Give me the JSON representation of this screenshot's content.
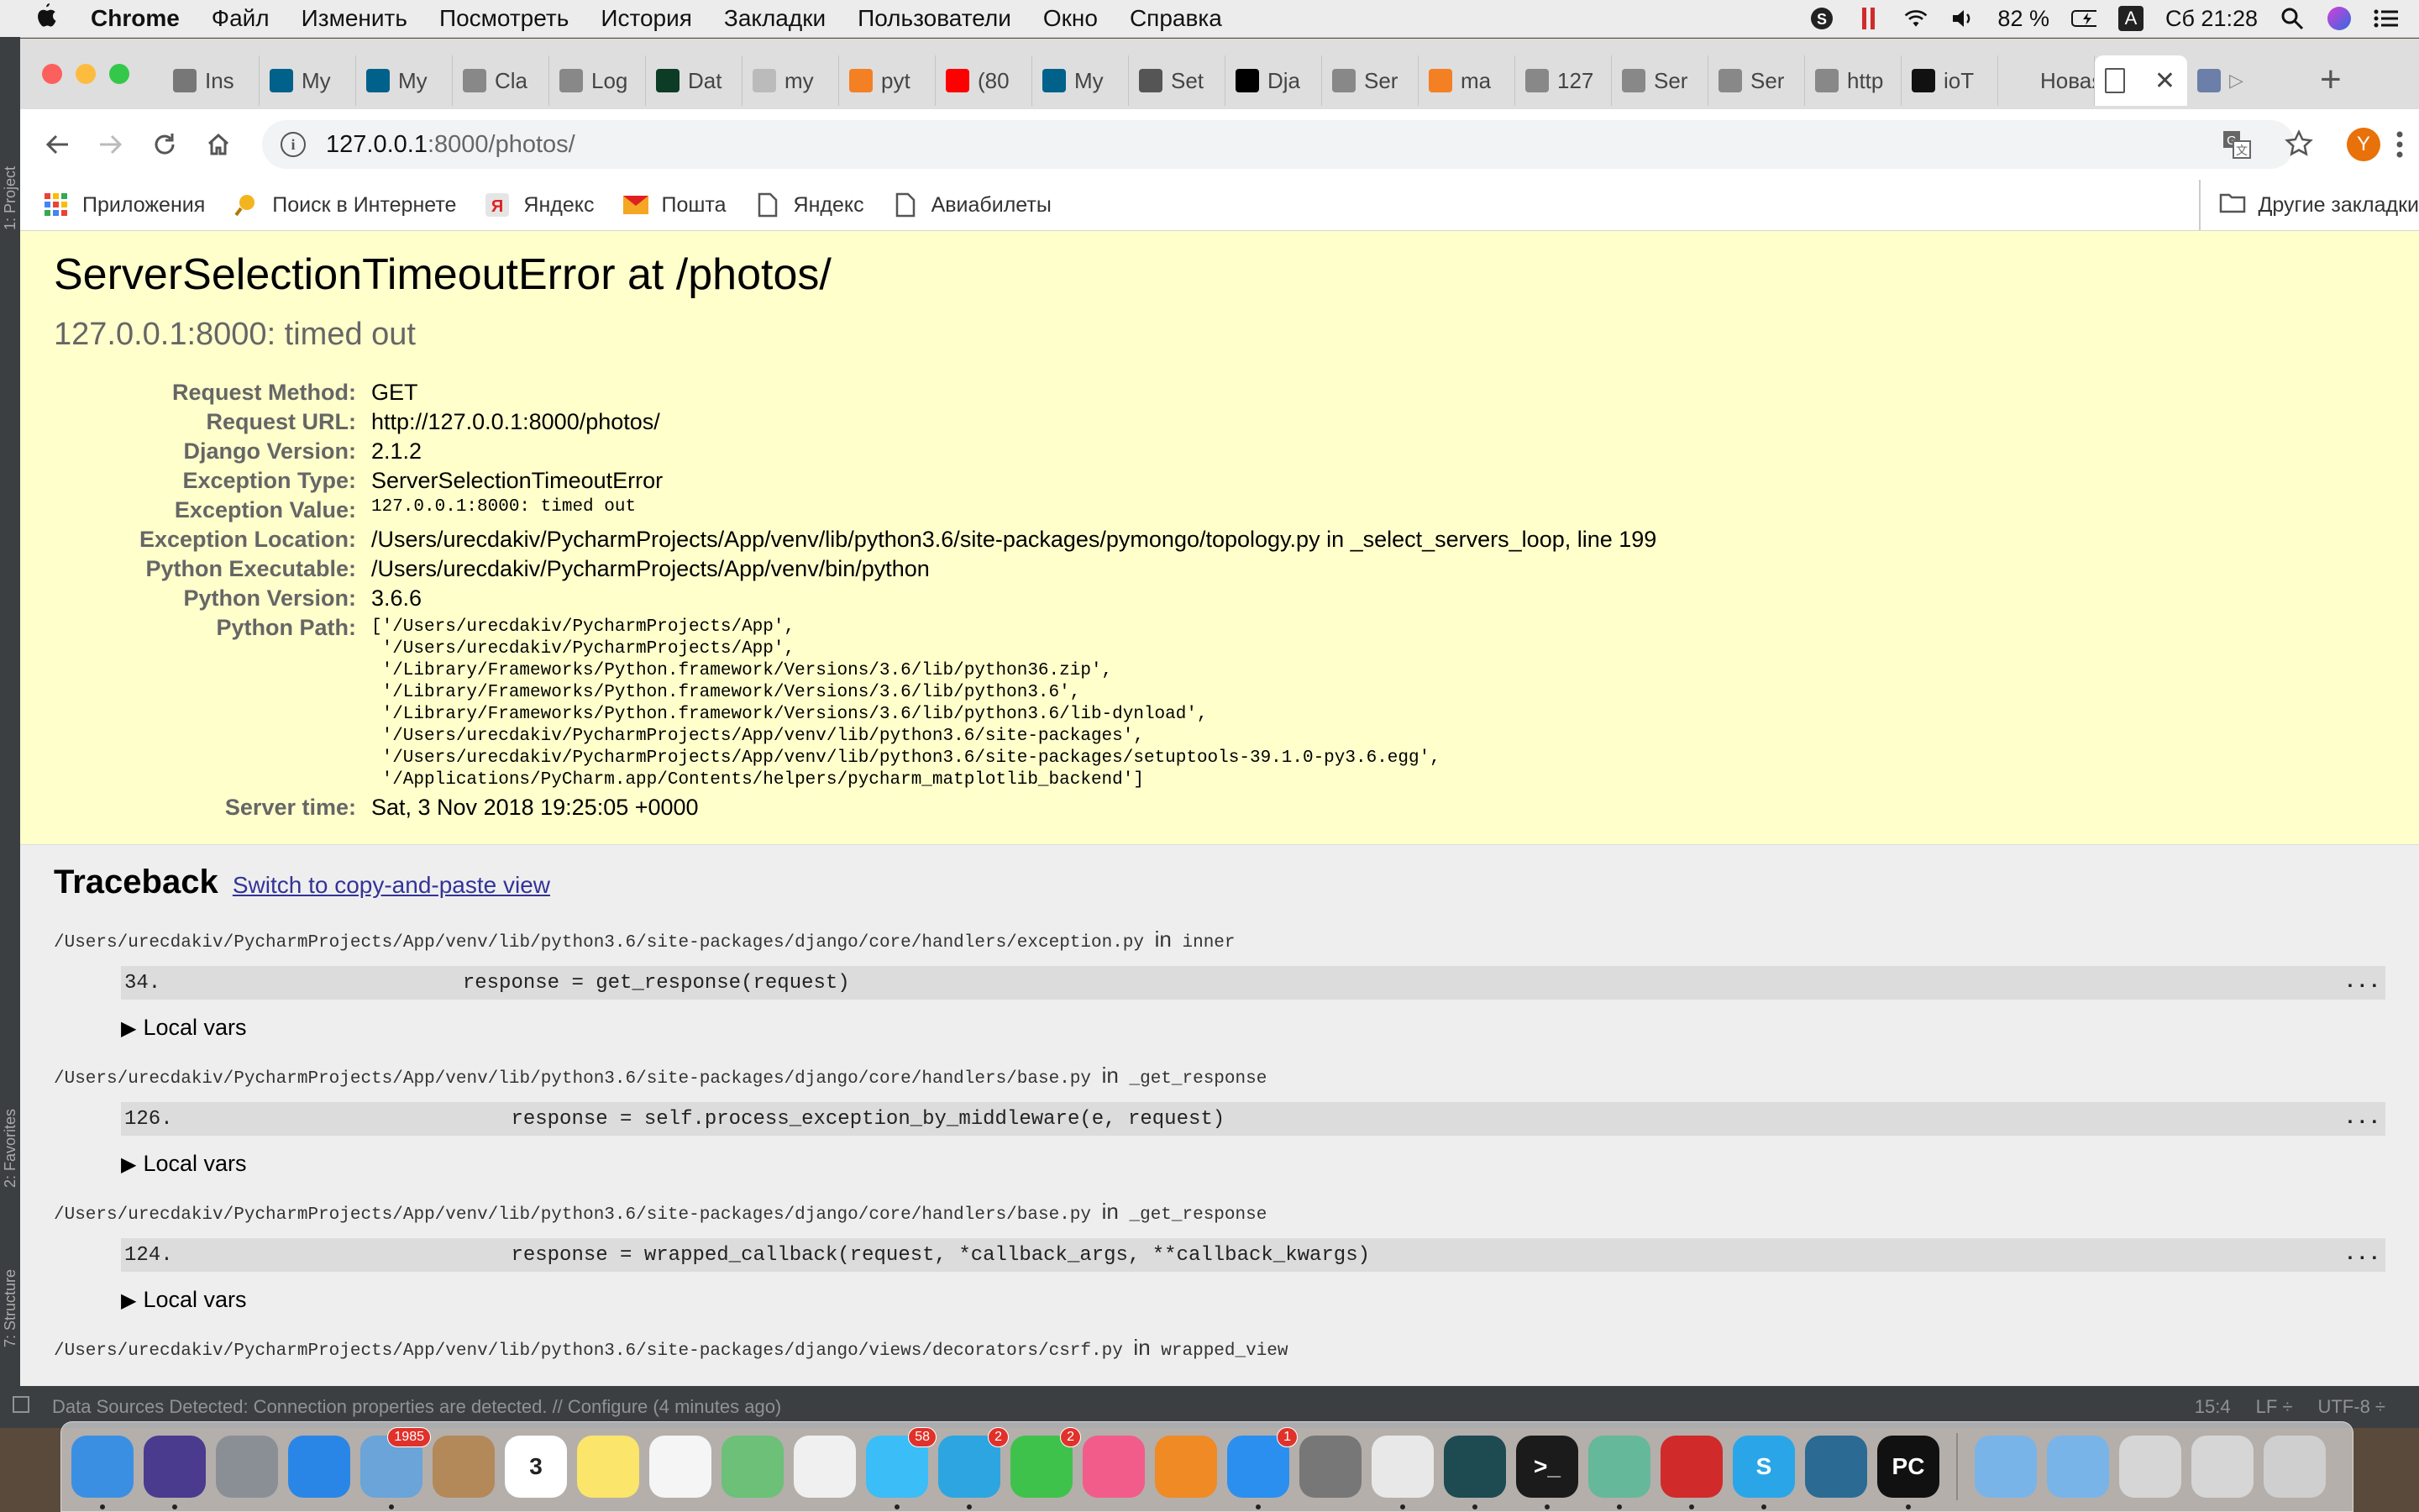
{
  "menubar": {
    "app_name": "Chrome",
    "items": [
      "Файл",
      "Изменить",
      "Посмотреть",
      "История",
      "Закладки",
      "Пользователи",
      "Окно",
      "Справка"
    ],
    "battery": "82 %",
    "input_lang": "A",
    "clock": "Сб 21:28"
  },
  "ide": {
    "side_tabs": [
      "1: Project",
      "2: Favorites",
      "7: Structure"
    ],
    "status_msg": "Data Sources Detected: Connection properties are detected. // Configure (4 minutes ago)",
    "position": "15:4",
    "line_sep": "LF ÷",
    "encoding": "UTF-8 ÷"
  },
  "tabs": [
    {
      "label": "Ins",
      "icon": "gear-icon",
      "color": "#777"
    },
    {
      "label": "My",
      "icon": "mysql-icon",
      "color": "#00618a"
    },
    {
      "label": "My",
      "icon": "mysql-icon",
      "color": "#00618a"
    },
    {
      "label": "Cla",
      "icon": "page-icon",
      "color": "#888"
    },
    {
      "label": "Log",
      "icon": "page-icon",
      "color": "#888"
    },
    {
      "label": "Dat",
      "icon": "django-icon",
      "color": "#0c3c26"
    },
    {
      "label": "my",
      "icon": "cube-icon",
      "color": "#bbb"
    },
    {
      "label": "pyt",
      "icon": "stackoverflow-icon",
      "color": "#f48024"
    },
    {
      "label": "(80",
      "icon": "youtube-icon",
      "color": "#ff0000"
    },
    {
      "label": "My",
      "icon": "mysql-icon",
      "color": "#00618a"
    },
    {
      "label": "Set",
      "icon": "table-icon",
      "color": "#555"
    },
    {
      "label": "Dja",
      "icon": "medium-icon",
      "color": "#000"
    },
    {
      "label": "Ser",
      "icon": "page-icon",
      "color": "#888"
    },
    {
      "label": "ma",
      "icon": "stackoverflow-icon",
      "color": "#f48024"
    },
    {
      "label": "127",
      "icon": "page-icon",
      "color": "#888"
    },
    {
      "label": "Ser",
      "icon": "page-icon",
      "color": "#888"
    },
    {
      "label": "Ser",
      "icon": "page-icon",
      "color": "#888"
    },
    {
      "label": "http",
      "icon": "page-icon",
      "color": "#888"
    },
    {
      "label": "ioT",
      "icon": "github-icon",
      "color": "#111"
    },
    {
      "label": "Новая",
      "icon": "",
      "color": ""
    }
  ],
  "active_tab": {
    "label": "",
    "close": "✕"
  },
  "address": {
    "host": "127.0.0.1",
    "path": ":8000/photos/"
  },
  "avatar_letter": "Y",
  "bookmarks": [
    {
      "label": "Приложения",
      "icon": "apps-grid-icon"
    },
    {
      "label": "Поиск в Интернете",
      "icon": "search-bookmark-icon"
    },
    {
      "label": "Яндекс",
      "icon": "yandex-icon"
    },
    {
      "label": "Пошта",
      "icon": "mail-icon"
    },
    {
      "label": "Яндекс",
      "icon": "page-icon"
    },
    {
      "label": "Авиабилеты",
      "icon": "page-icon"
    }
  ],
  "other_bookmarks": "Другие закладки",
  "error": {
    "title": "ServerSelectionTimeoutError at /photos/",
    "subtitle": "127.0.0.1:8000: timed out",
    "meta": [
      {
        "k": "Request Method:",
        "v": "GET"
      },
      {
        "k": "Request URL:",
        "v": "http://127.0.0.1:8000/photos/"
      },
      {
        "k": "Django Version:",
        "v": "2.1.2"
      },
      {
        "k": "Exception Type:",
        "v": "ServerSelectionTimeoutError"
      },
      {
        "k": "Exception Value:",
        "v": "127.0.0.1:8000: timed out",
        "mono": true
      },
      {
        "k": "Exception Location:",
        "v": "/Users/urecdakiv/PycharmProjects/App/venv/lib/python3.6/site-packages/pymongo/topology.py in _select_servers_loop, line 199"
      },
      {
        "k": "Python Executable:",
        "v": "/Users/urecdakiv/PycharmProjects/App/venv/bin/python"
      },
      {
        "k": "Python Version:",
        "v": "3.6.6"
      },
      {
        "k": "Python Path:",
        "v": "['/Users/urecdakiv/PycharmProjects/App',\n '/Users/urecdakiv/PycharmProjects/App',\n '/Library/Frameworks/Python.framework/Versions/3.6/lib/python36.zip',\n '/Library/Frameworks/Python.framework/Versions/3.6/lib/python3.6',\n '/Library/Frameworks/Python.framework/Versions/3.6/lib/python3.6/lib-dynload',\n '/Users/urecdakiv/PycharmProjects/App/venv/lib/python3.6/site-packages',\n '/Users/urecdakiv/PycharmProjects/App/venv/lib/python3.6/site-packages/setuptools-39.1.0-py3.6.egg',\n '/Applications/PyCharm.app/Contents/helpers/pycharm_matplotlib_backend']",
        "mono": true,
        "pre": true
      },
      {
        "k": "Server time:",
        "v": "Sat, 3 Nov 2018 19:25:05 +0000"
      }
    ]
  },
  "traceback": {
    "heading": "Traceback",
    "switch_link": "Switch to copy-and-paste view",
    "in_word": "in",
    "local_vars": "Local vars",
    "dots": "...",
    "frames": [
      {
        "file": "/Users/urecdakiv/PycharmProjects/App/venv/lib/python3.6/site-packages/django/core/handlers/exception.py",
        "func": "inner",
        "lineno": "34.",
        "code": "            response = get_response(request)"
      },
      {
        "file": "/Users/urecdakiv/PycharmProjects/App/venv/lib/python3.6/site-packages/django/core/handlers/base.py",
        "func": "_get_response",
        "lineno": "126.",
        "code": "                response = self.process_exception_by_middleware(e, request)"
      },
      {
        "file": "/Users/urecdakiv/PycharmProjects/App/venv/lib/python3.6/site-packages/django/core/handlers/base.py",
        "func": "_get_response",
        "lineno": "124.",
        "code": "                response = wrapped_callback(request, *callback_args, **callback_kwargs)"
      },
      {
        "file": "/Users/urecdakiv/PycharmProjects/App/venv/lib/python3.6/site-packages/django/views/decorators/csrf.py",
        "func": "wrapped_view",
        "lineno": "",
        "code": ""
      }
    ]
  },
  "dock": {
    "apps": [
      {
        "name": "finder-icon",
        "color": "#3b8fe3",
        "text": ""
      },
      {
        "name": "siri-icon",
        "color": "#4a3b8f",
        "text": ""
      },
      {
        "name": "launchpad-icon",
        "color": "#8a8f96",
        "text": ""
      },
      {
        "name": "safari-icon",
        "color": "#2a86e6",
        "text": ""
      },
      {
        "name": "mail-app-icon",
        "color": "#6aa4d8",
        "text": "",
        "badge": "1985"
      },
      {
        "name": "contacts-icon",
        "color": "#b3895a",
        "text": ""
      },
      {
        "name": "calendar-icon",
        "color": "#ffffff",
        "text": "3",
        "textcolor": "#222"
      },
      {
        "name": "notes-icon",
        "color": "#fbe56a",
        "text": ""
      },
      {
        "name": "reminders-icon",
        "color": "#f5f5f5",
        "text": ""
      },
      {
        "name": "maps-icon",
        "color": "#6cc077",
        "text": ""
      },
      {
        "name": "photos-icon",
        "color": "#f0f0f0",
        "text": ""
      },
      {
        "name": "messages-icon",
        "color": "#3bbdf7",
        "text": "",
        "badge": "58"
      },
      {
        "name": "telegram-icon",
        "color": "#2ca5e0",
        "text": "",
        "badge": "2"
      },
      {
        "name": "facetime-icon",
        "color": "#3fc24c",
        "text": "",
        "badge": "2"
      },
      {
        "name": "itunes-icon",
        "color": "#f25c8a",
        "text": ""
      },
      {
        "name": "ibooks-icon",
        "color": "#f08a24",
        "text": ""
      },
      {
        "name": "appstore-icon",
        "color": "#2b8ff0",
        "text": "",
        "badge": "1"
      },
      {
        "name": "system-preferences-icon",
        "color": "#777",
        "text": ""
      },
      {
        "name": "chrome-icon",
        "color": "#e8e8e8",
        "text": ""
      },
      {
        "name": "gitkraken-icon",
        "color": "#1e4a52",
        "text": ""
      },
      {
        "name": "terminal-icon",
        "color": "#1b1b1b",
        "text": ">_"
      },
      {
        "name": "atom-icon",
        "color": "#66b89a",
        "text": ""
      },
      {
        "name": "parallels-icon",
        "color": "#d12a2a",
        "text": ""
      },
      {
        "name": "skype-icon",
        "color": "#2aa6e8",
        "text": "S"
      },
      {
        "name": "mysql-workbench-icon",
        "color": "#2b6a93",
        "text": ""
      },
      {
        "name": "pycharm-icon",
        "color": "#111",
        "text": "PC"
      }
    ],
    "folders": [
      {
        "name": "applications-folder-icon",
        "color": "#79b4e8"
      },
      {
        "name": "documents-folder-icon",
        "color": "#79b4e8"
      },
      {
        "name": "downloads-stack-icon",
        "color": "#d6d6d6"
      },
      {
        "name": "screenshot-stack-icon",
        "color": "#d6d6d6"
      },
      {
        "name": "trash-icon",
        "color": "#cfcfcf"
      }
    ]
  }
}
